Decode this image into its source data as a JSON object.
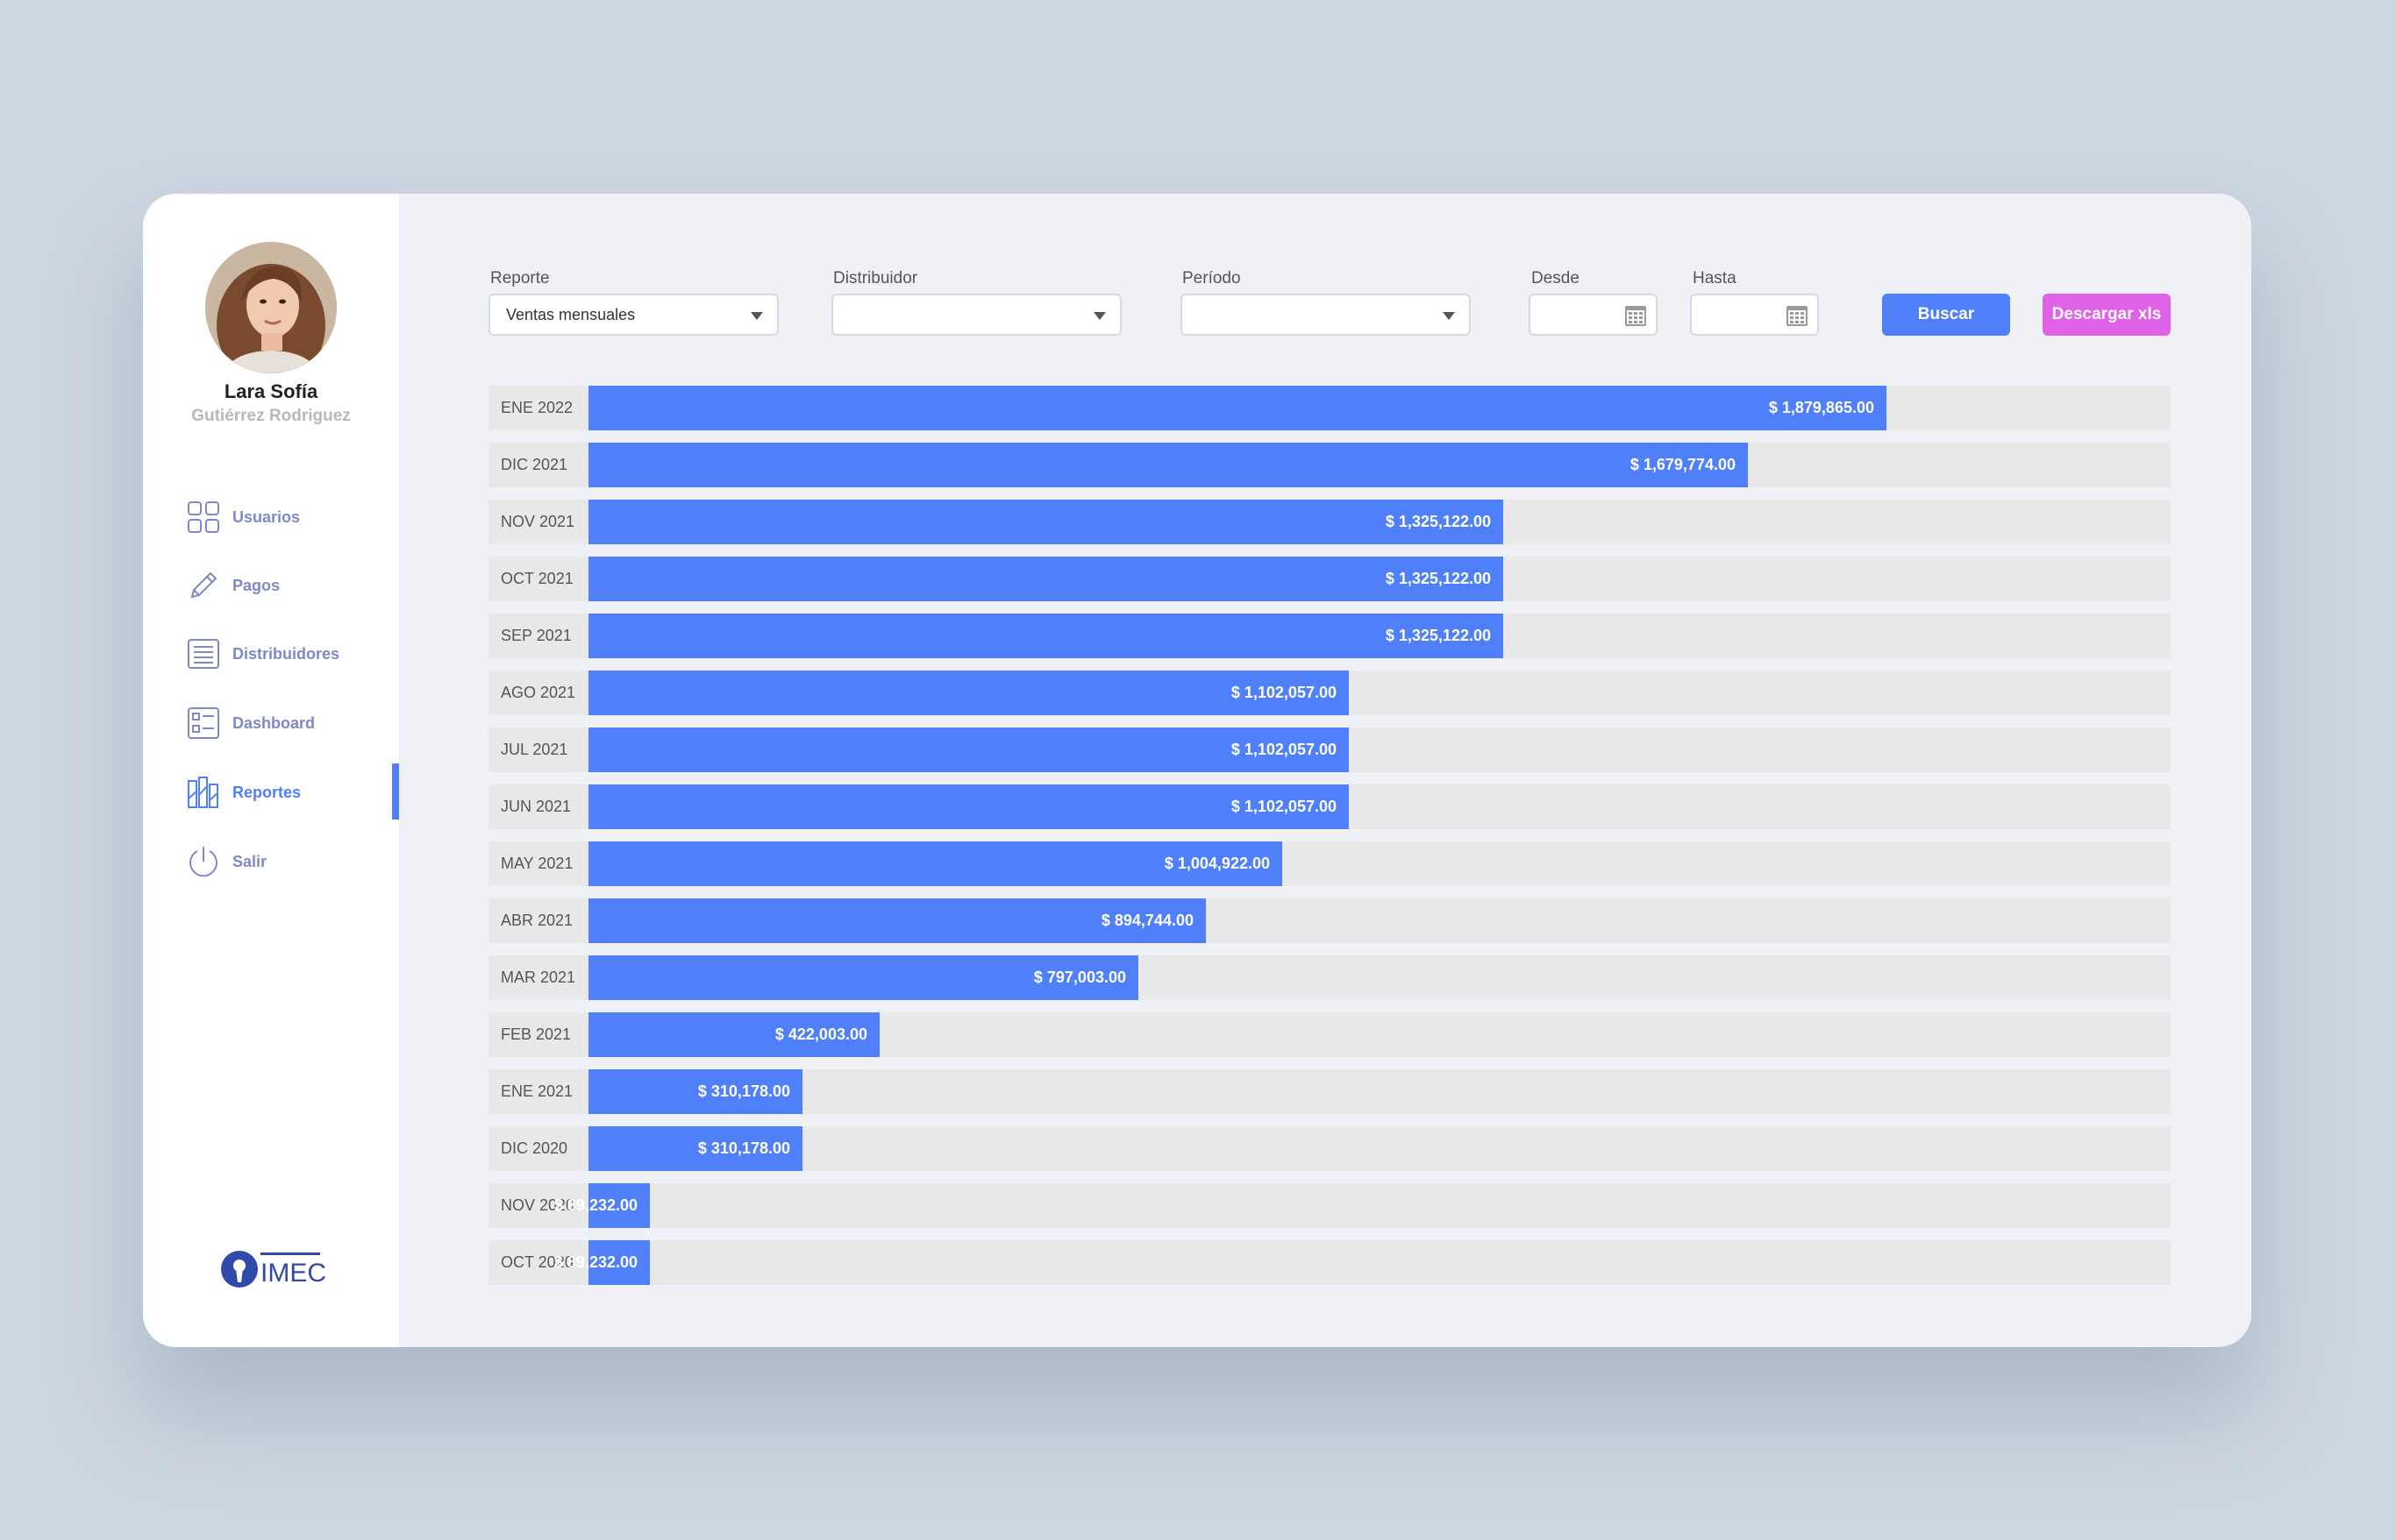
{
  "user": {
    "first_name": "Lara Sofía",
    "last_name": "Gutiérrez Rodriguez"
  },
  "sidebar": {
    "items": [
      {
        "label": "Usuarios",
        "icon": "grid-icon"
      },
      {
        "label": "Pagos",
        "icon": "pencil-icon"
      },
      {
        "label": "Distribuidores",
        "icon": "list-icon"
      },
      {
        "label": "Dashboard",
        "icon": "checklist-icon"
      },
      {
        "label": "Reportes",
        "icon": "reports-icon",
        "active": true
      },
      {
        "label": "Salir",
        "icon": "power-icon"
      }
    ],
    "logo_text": "IMEC"
  },
  "filters": {
    "reporte_label": "Reporte",
    "reporte_value": "Ventas mensuales",
    "distribuidor_label": "Distribuidor",
    "distribuidor_value": "",
    "periodo_label": "Período",
    "periodo_value": "",
    "desde_label": "Desde",
    "hasta_label": "Hasta"
  },
  "actions": {
    "buscar_label": "Buscar",
    "descargar_label": "Descargar xls"
  },
  "colors": {
    "accent": "#4f80fa",
    "download": "#e062e8",
    "track": "#e8e8e9"
  },
  "chart_data": {
    "type": "bar",
    "orientation": "horizontal",
    "max": 2292000,
    "categories": [
      "ENE 2022",
      "DIC 2021",
      "NOV 2021",
      "OCT 2021",
      "SEP 2021",
      "AGO 2021",
      "JUL 2021",
      "JUN 2021",
      "MAY 2021",
      "ABR 2021",
      "MAR 2021",
      "FEB 2021",
      "ENE 2021",
      "DIC 2020",
      "NOV 2020",
      "OCT 2020"
    ],
    "values": [
      1879865,
      1679774,
      1325122,
      1325122,
      1325122,
      1102057,
      1102057,
      1102057,
      1004922,
      894744,
      797003,
      422003,
      310178,
      310178,
      89232,
      89232
    ],
    "labels": [
      "$ 1,879,865.00",
      "$ 1,679,774.00",
      "$ 1,325,122.00",
      "$ 1,325,122.00",
      "$ 1,325,122.00",
      "$ 1,102,057.00",
      "$ 1,102,057.00",
      "$ 1,102,057.00",
      "$ 1,004,922.00",
      "$ 894,744.00",
      "$ 797,003.00",
      "$ 422,003.00",
      "$ 310,178.00",
      "$ 310,178.00",
      "$ 89,232.00",
      "$ 89,232.00"
    ]
  }
}
